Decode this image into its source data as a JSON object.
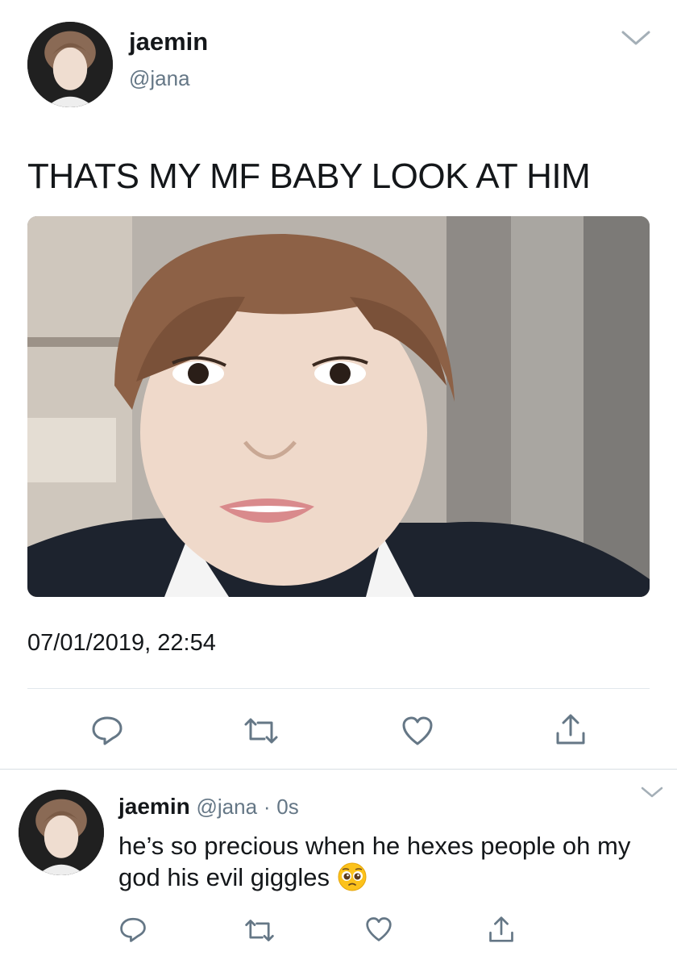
{
  "tweet": {
    "display_name": "jaemin",
    "handle": "@jana",
    "text": "THATS MY MF BABY LOOK AT HIM",
    "timestamp": "07/01/2019, 22:54"
  },
  "reply": {
    "display_name": "jaemin",
    "handle": "@jana",
    "separator": "·",
    "time": "0s",
    "text": "he’s so precious when he hexes people oh my god his evil giggles",
    "emoji": "pleading-face"
  },
  "icons": {
    "reply": "reply-icon",
    "retweet": "retweet-icon",
    "like": "heart-icon",
    "share": "share-icon",
    "more": "chevron-down-icon"
  },
  "colors": {
    "text": "#14171a",
    "secondary": "#657786",
    "icon": "#657786",
    "divider": "#e1e8ed"
  }
}
